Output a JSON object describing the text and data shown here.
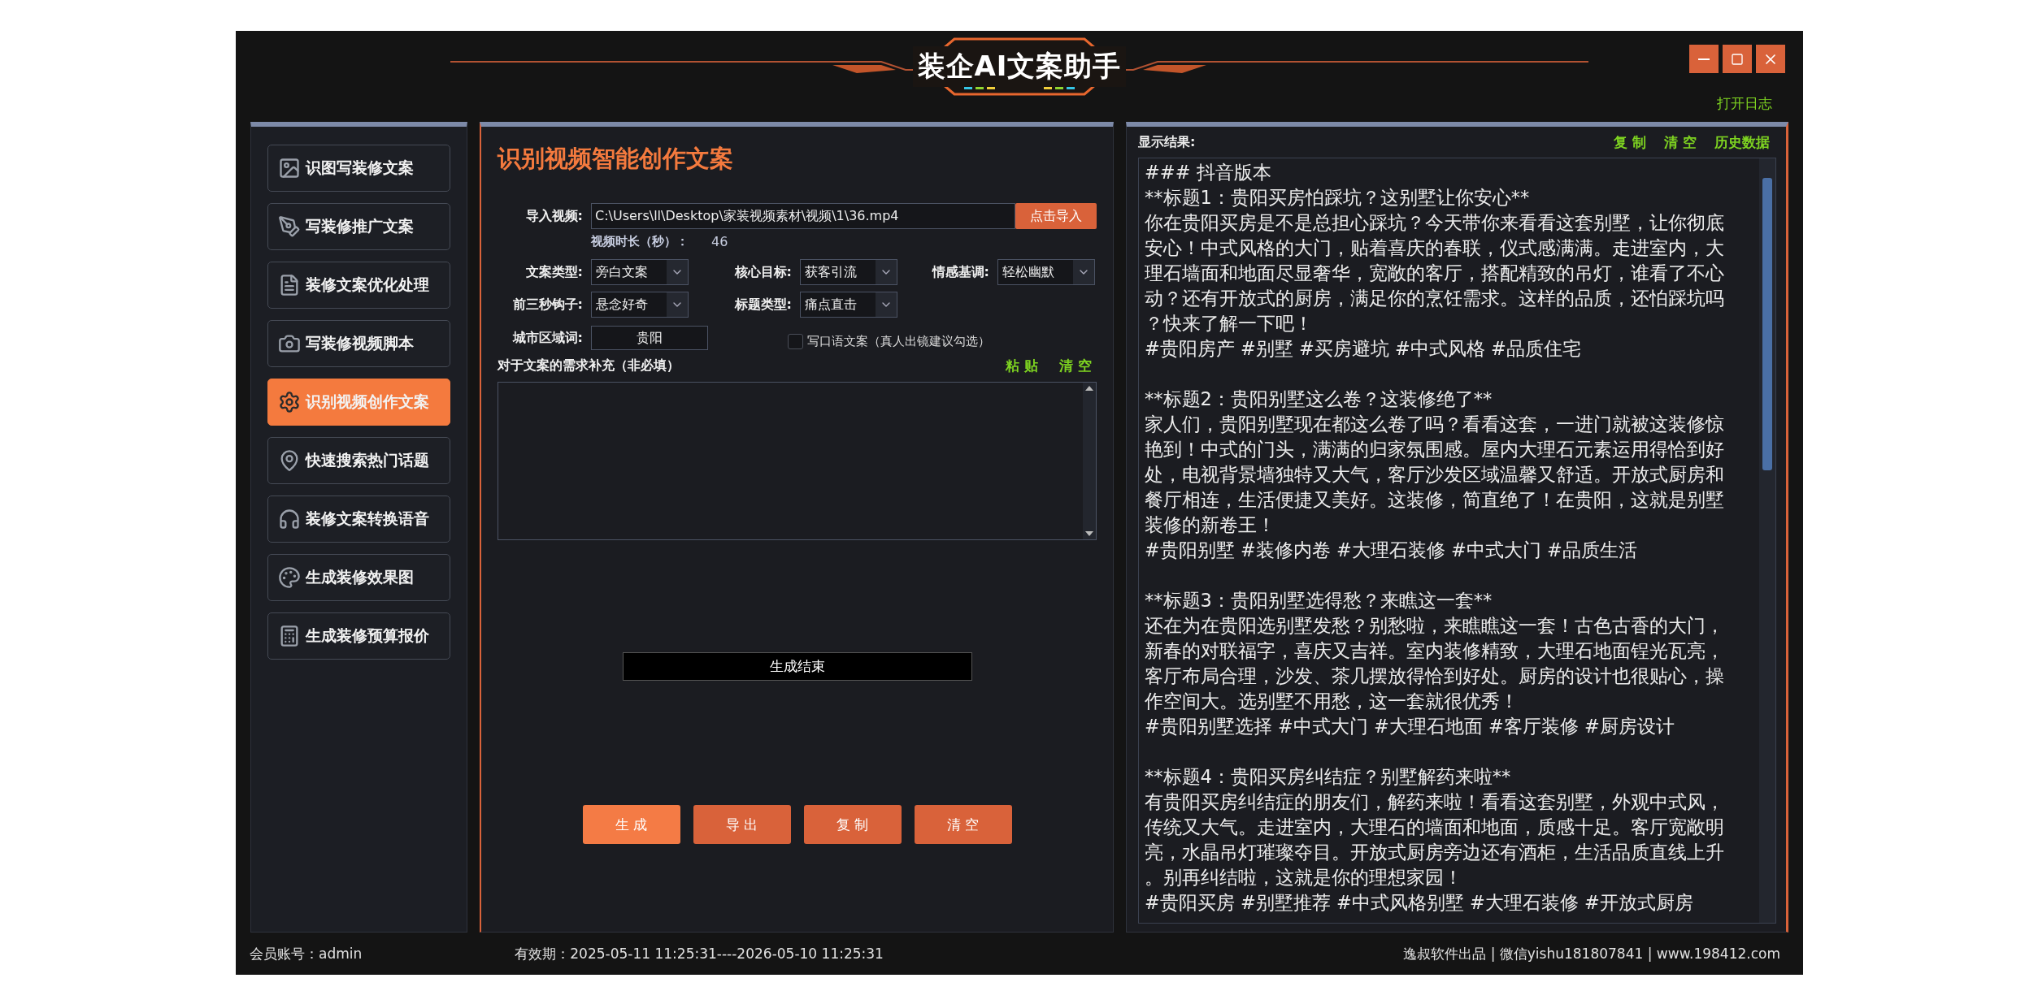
{
  "window": {
    "title": "装企AI文案助手",
    "log_link": "打开日志"
  },
  "sidebar": {
    "items": [
      {
        "label": "识图写装修文案",
        "selected": false
      },
      {
        "label": "写装修推广文案",
        "selected": false
      },
      {
        "label": "装修文案优化处理",
        "selected": false
      },
      {
        "label": "写装修视频脚本",
        "selected": false
      },
      {
        "label": "识别视频创作文案",
        "selected": true
      },
      {
        "label": "快速搜索热门话题",
        "selected": false
      },
      {
        "label": "装修文案转换语音",
        "selected": false
      },
      {
        "label": "生成装修效果图",
        "selected": false
      },
      {
        "label": "生成装修预算报价",
        "selected": false
      }
    ]
  },
  "editor": {
    "title": "识别视频智能创作文案",
    "video": {
      "label": "导入视频:",
      "value": "C:\\Users\\ll\\Desktop\\家装视频素材\\视频\\1\\36.mp4",
      "button": "点击导入"
    },
    "duration": {
      "label": "视频时长（秒）：",
      "value": "46"
    },
    "options": [
      {
        "label": "文案类型:",
        "value": "旁白文案"
      },
      {
        "label": "核心目标:",
        "value": "获客引流"
      },
      {
        "label": "情感基调:",
        "value": "轻松幽默"
      },
      {
        "label": "前三秒钩子:",
        "value": "悬念好奇"
      },
      {
        "label": "标题类型:",
        "value": "痛点直击"
      }
    ],
    "city": {
      "label": "城市区域词:",
      "value": "贵阳"
    },
    "spoken": {
      "label": "写口语文案（真人出镜建议勾选）",
      "checked": false
    },
    "notes": {
      "label": "对于文案的需求补充（非必填）",
      "actions": [
        "粘 贴",
        "清 空"
      ]
    },
    "status": "生成结束",
    "buttons": [
      {
        "label": "生 成",
        "highlighted": true
      },
      {
        "label": "导 出",
        "highlighted": false
      },
      {
        "label": "复 制",
        "highlighted": false
      },
      {
        "label": "清 空",
        "highlighted": false
      }
    ]
  },
  "results": {
    "label": "显示结果:",
    "actions": [
      "复 制",
      "清 空",
      "历史数据"
    ],
    "blocks": [
      [
        "### 抖音版本",
        "**标题1：贵阳买房怕踩坑？这别墅让你安心**",
        "你在贵阳买房是不是总担心踩坑？今天带你来看看这套别墅，让你彻底",
        "安心！中式风格的大门，贴着喜庆的春联，仪式感满满。走进室内，大",
        "理石墙面和地面尽显奢华，宽敞的客厅，搭配精致的吊灯，谁看了不心",
        "动？还有开放式的厨房，满足你的烹饪需求。这样的品质，还怕踩坑吗",
        "？快来了解一下吧！",
        "#贵阳房产 #别墅 #买房避坑 #中式风格 #品质住宅"
      ],
      [
        "**标题2：贵阳别墅这么卷？这装修绝了**",
        "家人们，贵阳别墅现在都这么卷了吗？看看这套，一进门就被这装修惊",
        "艳到！中式的门头，满满的归家氛围感。屋内大理石元素运用得恰到好",
        "处，电视背景墙独特又大气，客厅沙发区域温馨又舒适。开放式厨房和",
        "餐厅相连，生活便捷又美好。这装修，简直绝了！在贵阳，这就是别墅",
        "装修的新卷王！",
        "#贵阳别墅 #装修内卷 #大理石装修 #中式大门 #品质生活"
      ],
      [
        "**标题3：贵阳别墅选得愁？来瞧这一套**",
        "还在为在贵阳选别墅发愁？别愁啦，来瞧瞧这一套！古色古香的大门，",
        "新春的对联福字，喜庆又吉祥。室内装修精致，大理石地面锃光瓦亮，",
        "客厅布局合理，沙发、茶几摆放得恰到好处。厨房的设计也很贴心，操",
        "作空间大。选别墅不用愁，这一套就很优秀！",
        "#贵阳别墅选择 #中式大门 #大理石地面 #客厅装修 #厨房设计"
      ],
      [
        "**标题4：贵阳买房纠结症？别墅解药来啦**",
        "有贵阳买房纠结症的朋友们，解药来啦！看看这套别墅，外观中式风，",
        "传统又大气。走进室内，大理石的墙面和地面，质感十足。客厅宽敞明",
        "亮，水晶吊灯璀璨夺目。开放式厨房旁边还有酒柜，生活品质直线上升",
        "。别再纠结啦，这就是你的理想家园！",
        "#贵阳买房 #别墅推荐 #中式风格别墅 #大理石装修 #开放式厨房"
      ]
    ]
  },
  "status_bar": {
    "account": "会员账号：admin",
    "validity": "有效期：2025-05-11 11:25:31----2026-05-10 11:25:31",
    "credits": "逸叔软件出品 | 微信yishu181807841 | www.198412.com"
  }
}
